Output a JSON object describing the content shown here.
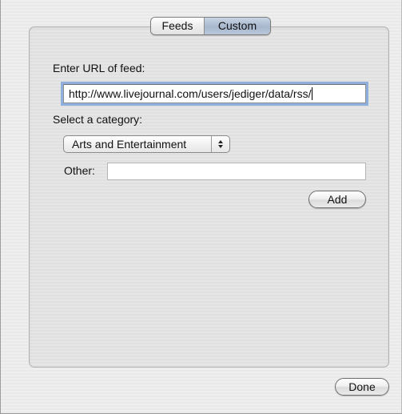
{
  "tabs": {
    "feeds": "Feeds",
    "custom": "Custom",
    "selected": "custom"
  },
  "url_section": {
    "label": "Enter URL of feed:",
    "value": "http://www.livejournal.com/users/jediger/data/rss/"
  },
  "category_section": {
    "label": "Select a category:",
    "selected_option": "Arts and Entertainment"
  },
  "other_field": {
    "label": "Other:",
    "value": ""
  },
  "buttons": {
    "add": "Add",
    "done": "Done"
  }
}
